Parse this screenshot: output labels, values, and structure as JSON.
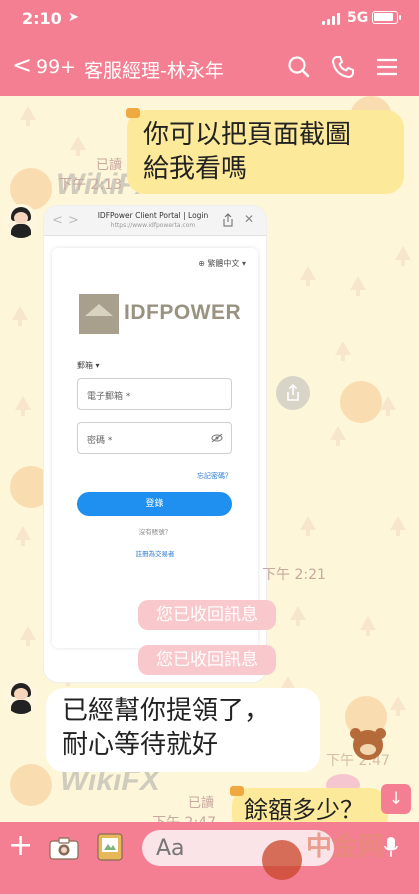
{
  "status_bar": {
    "time": "2:10",
    "network": "5G"
  },
  "header": {
    "back_count": "99+",
    "title": "客服經理-林永年"
  },
  "messages": {
    "m1": {
      "line1": "你可以把頁面截圖",
      "line2": "給我看嗎",
      "read": "已讀",
      "time": "下午 2:13"
    },
    "image_time": "下午 2:21",
    "recall_1": "您已收回訊息",
    "recall_2": "您已收回訊息",
    "m2": {
      "line1": "已經幫你提領了，",
      "line2": "耐心等待就好"
    },
    "m2_time": "下午 2:47",
    "m3": {
      "text": "餘額多少？",
      "read": "已讀",
      "time": "下午 2:47"
    }
  },
  "shared_screenshot": {
    "page_title": "IDFPower Client Portal | Login",
    "url": "https://www.idfpowerta.com",
    "language": "繁體中文",
    "brand": "IDFPOWER",
    "login_type": "郵箱",
    "email_placeholder": "電子郵箱 *",
    "password_placeholder": "密碼 *",
    "forgot": "忘記密碼？",
    "login_button": "登錄",
    "no_account": "沒有賬號？",
    "register": "註冊為交易者"
  },
  "watermark": {
    "text": "WikiFX",
    "corner": "中金网"
  },
  "composer": {
    "placeholder": "Aa"
  },
  "colors": {
    "brand_pink": "#f57f92",
    "my_bubble": "#fde99a",
    "chat_bg": "#fdf6d8",
    "recall_pill": "#f9c8cc"
  }
}
